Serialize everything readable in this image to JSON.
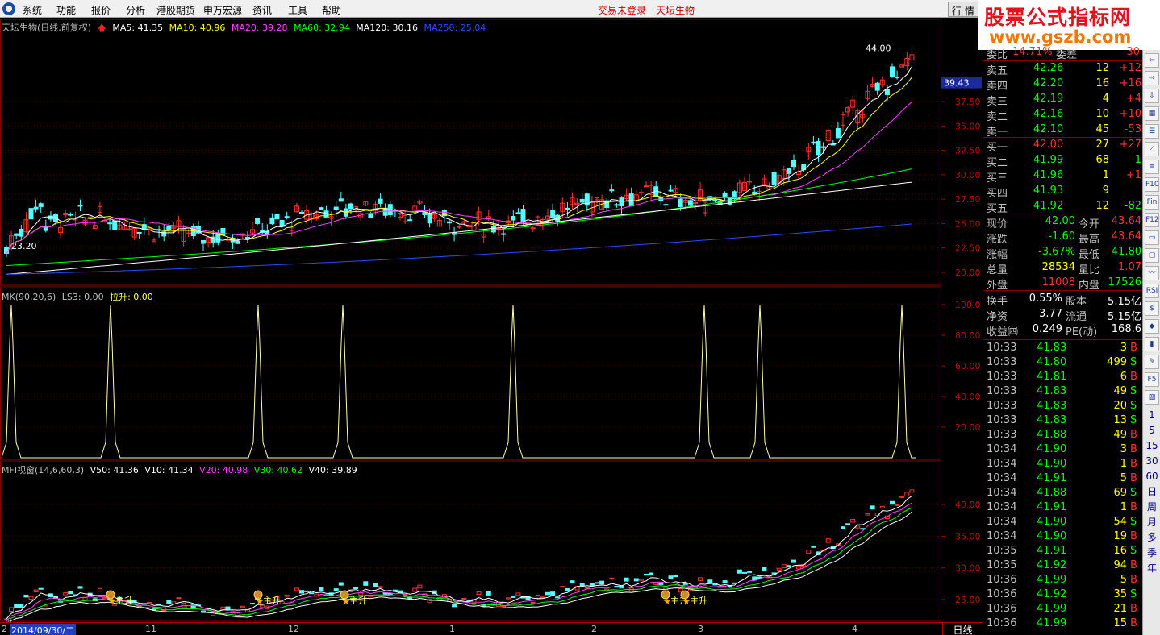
{
  "menubar": {
    "items": [
      "系统",
      "功能",
      "报价",
      "分析",
      "港股期货",
      "申万宏源",
      "资讯",
      "工具",
      "帮助"
    ],
    "login_status": "交易未登录",
    "stock_name": "天坛生物",
    "right_tab": "行  情"
  },
  "watermark": {
    "line1": "股票公式指标网",
    "line2": "www.gszb.com"
  },
  "main_panel": {
    "title": "天坛生物(日线,前复权)",
    "ma": [
      {
        "label": "MA5: 41.35",
        "color": "#ffffff"
      },
      {
        "label": "MA10: 40.96",
        "color": "#ffff00"
      },
      {
        "label": "MA20: 39.28",
        "color": "#ff40ff"
      },
      {
        "label": "MA60: 32.94",
        "color": "#00ff00"
      },
      {
        "label": "MA120: 30.16",
        "color": "#ffffff"
      },
      {
        "label": "MA250: 25.04",
        "color": "#2a4aff"
      }
    ],
    "y_ticks": [
      "37.50",
      "35.00",
      "32.50",
      "30.00",
      "27.50",
      "25.00",
      "22.50",
      "20.00"
    ],
    "current_price_tag": "39.43",
    "high_label": "44.00",
    "low_label": "23.20"
  },
  "mk_panel": {
    "title": "MK(90,20,6)",
    "ls3": "LS3: 0.00",
    "lasheng": "拉升: 0.00",
    "y_ticks": [
      "100.0",
      "80.00",
      "60.00",
      "40.00",
      "20.00"
    ],
    "spikes": [
      14,
      137,
      320,
      425,
      636,
      873,
      942,
      1118
    ]
  },
  "mfi_panel": {
    "title": "MFI视窗(14,6,60,3)",
    "values": [
      {
        "label": "V50: 41.36",
        "color": "#ffffff"
      },
      {
        "label": "V10: 41.34",
        "color": "#ffffff"
      },
      {
        "label": "V20: 40.98",
        "color": "#ff40ff"
      },
      {
        "label": "V30: 40.62",
        "color": "#00ff00"
      },
      {
        "label": "V40: 39.89",
        "color": "#ffffff"
      }
    ],
    "y_ticks": [
      "40.00",
      "35.00",
      "30.00",
      "25.00"
    ],
    "signal_label": "主升"
  },
  "xaxis": {
    "date_box": "2014/09/30/二",
    "months": [
      "11",
      "12",
      "1",
      "2",
      "3",
      "4"
    ],
    "first_digit": "2",
    "period": "日线"
  },
  "quote": {
    "wei_bi": {
      "label": "委比",
      "value": "14.71%",
      "label2": "委差",
      "value2": "30"
    },
    "sells": [
      {
        "label": "卖五",
        "price": "42.26",
        "vol": "12",
        "chg": "+12"
      },
      {
        "label": "卖四",
        "price": "42.20",
        "vol": "16",
        "chg": "+16"
      },
      {
        "label": "卖三",
        "price": "42.19",
        "vol": "4",
        "chg": "+4"
      },
      {
        "label": "卖二",
        "price": "42.16",
        "vol": "10",
        "chg": "+10"
      },
      {
        "label": "卖一",
        "price": "42.10",
        "vol": "45",
        "chg": "-53"
      }
    ],
    "buys": [
      {
        "label": "买一",
        "price": "42.00",
        "vol": "27",
        "chg": "+27"
      },
      {
        "label": "买二",
        "price": "41.99",
        "vol": "68",
        "chg": "-1"
      },
      {
        "label": "买三",
        "price": "41.96",
        "vol": "1",
        "chg": "+1"
      },
      {
        "label": "买四",
        "price": "41.93",
        "vol": "9",
        "chg": ""
      },
      {
        "label": "买五",
        "price": "41.92",
        "vol": "12",
        "chg": "-82"
      }
    ],
    "stats": [
      {
        "l1": "现价",
        "v1": "42.00",
        "c1": "#00ff00",
        "l2": "今开",
        "v2": "43.64",
        "c2": "#ff3030"
      },
      {
        "l1": "涨跌",
        "v1": "-1.60",
        "c1": "#00ff00",
        "l2": "最高",
        "v2": "43.64",
        "c2": "#ff3030"
      },
      {
        "l1": "涨幅",
        "v1": "-3.67%",
        "c1": "#00ff00",
        "l2": "最低",
        "v2": "41.80",
        "c2": "#00ff00"
      },
      {
        "l1": "总量",
        "v1": "28534",
        "c1": "#ffff00",
        "l2": "量比",
        "v2": "1.07",
        "c2": "#ff3030"
      },
      {
        "l1": "外盘",
        "v1": "11008",
        "c1": "#ff3030",
        "l2": "内盘",
        "v2": "17526",
        "c2": "#00ff00"
      }
    ],
    "fund": [
      {
        "l1": "换手",
        "v1": "0.55%",
        "l2": "股本",
        "v2": "5.15亿"
      },
      {
        "l1": "净资",
        "v1": "3.77",
        "l2": "流通",
        "v2": "5.15亿"
      },
      {
        "l1": "收益㈣",
        "v1": "0.249",
        "l2": "PE(动)",
        "v2": "168.6"
      }
    ],
    "ticks": [
      {
        "time": "10:33",
        "price": "41.83",
        "vol": "3",
        "side": "B"
      },
      {
        "time": "10:33",
        "price": "41.80",
        "vol": "499",
        "side": "S"
      },
      {
        "time": "10:33",
        "price": "41.81",
        "vol": "6",
        "side": "B"
      },
      {
        "time": "10:33",
        "price": "41.83",
        "vol": "49",
        "side": "S"
      },
      {
        "time": "10:33",
        "price": "41.83",
        "vol": "20",
        "side": "S"
      },
      {
        "time": "10:33",
        "price": "41.83",
        "vol": "13",
        "side": "S"
      },
      {
        "time": "10:33",
        "price": "41.88",
        "vol": "49",
        "side": "B"
      },
      {
        "time": "10:34",
        "price": "41.90",
        "vol": "3",
        "side": "B"
      },
      {
        "time": "10:34",
        "price": "41.90",
        "vol": "1",
        "side": "B"
      },
      {
        "time": "10:34",
        "price": "41.91",
        "vol": "5",
        "side": "B"
      },
      {
        "time": "10:34",
        "price": "41.88",
        "vol": "69",
        "side": "S"
      },
      {
        "time": "10:34",
        "price": "41.91",
        "vol": "1",
        "side": "B"
      },
      {
        "time": "10:34",
        "price": "41.90",
        "vol": "54",
        "side": "S"
      },
      {
        "time": "10:34",
        "price": "41.90",
        "vol": "19",
        "side": "B"
      },
      {
        "time": "10:35",
        "price": "41.91",
        "vol": "16",
        "side": "S"
      },
      {
        "time": "10:35",
        "price": "41.92",
        "vol": "94",
        "side": "B"
      },
      {
        "time": "10:36",
        "price": "41.99",
        "vol": "5",
        "side": "B"
      },
      {
        "time": "10:36",
        "price": "41.92",
        "vol": "35",
        "side": "S"
      },
      {
        "time": "10:36",
        "price": "41.99",
        "vol": "21",
        "side": "B"
      },
      {
        "time": "10:36",
        "price": "41.99",
        "vol": "15",
        "side": "B"
      }
    ]
  },
  "toolbar": {
    "icons": [
      "arrow-left-icon",
      "arrow-right-icon",
      "arrow-down-icon",
      "grid-icon",
      "list-icon",
      "line-chart-icon",
      "menu-icon",
      "f10-icon",
      "fin-icon",
      "f12-icon",
      "window-icon",
      "square-icon",
      "wave-icon",
      "rsi-icon",
      "dollar-icon",
      "diamond-icon",
      "candle-icon",
      "pencil-icon",
      "f5-icon",
      "image-icon"
    ],
    "periods": [
      "1",
      "5",
      "15",
      "30",
      "60",
      "日",
      "周",
      "月",
      "多",
      "季",
      "年"
    ]
  }
}
